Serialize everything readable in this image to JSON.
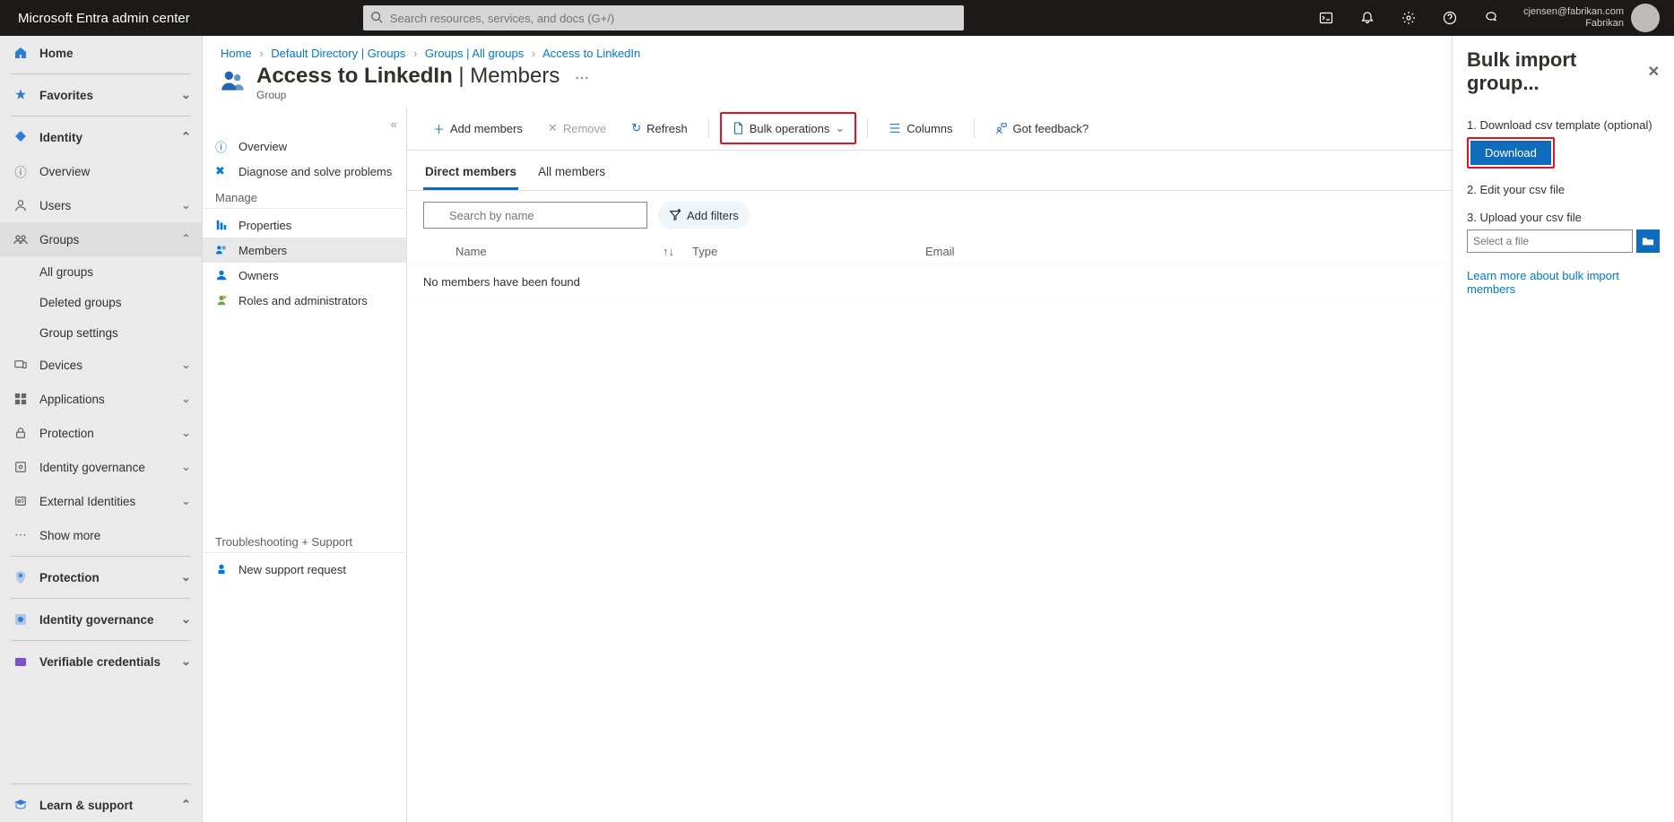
{
  "topbar": {
    "brand": "Microsoft Entra admin center",
    "search_placeholder": "Search resources, services, and docs (G+/)",
    "user_email": "cjensen@fabrikan.com",
    "user_tenant": "Fabrikan"
  },
  "sidebar": {
    "home": "Home",
    "favorites": "Favorites",
    "identity": "Identity",
    "overview": "Overview",
    "users": "Users",
    "groups": "Groups",
    "all_groups": "All groups",
    "deleted_groups": "Deleted groups",
    "group_settings": "Group settings",
    "devices": "Devices",
    "applications": "Applications",
    "protection": "Protection",
    "id_gov": "Identity governance",
    "ext_ids": "External Identities",
    "show_more": "Show more",
    "protection2": "Protection",
    "id_gov2": "Identity governance",
    "vc": "Verifiable credentials",
    "learn": "Learn & support"
  },
  "resmenu": {
    "overview": "Overview",
    "diagnose": "Diagnose and solve problems",
    "manage_h": "Manage",
    "properties": "Properties",
    "members": "Members",
    "owners": "Owners",
    "roles": "Roles and administrators",
    "trouble_h": "Troubleshooting + Support",
    "support": "New support request"
  },
  "breadcrumb": {
    "home": "Home",
    "dir": "Default Directory | Groups",
    "all": "Groups | All groups",
    "grp": "Access to LinkedIn"
  },
  "header": {
    "title_strong": "Access to LinkedIn",
    "title_thin": " | Members",
    "subtitle": "Group"
  },
  "commands": {
    "add": "Add members",
    "remove": "Remove",
    "refresh": "Refresh",
    "bulk": "Bulk operations",
    "columns": "Columns",
    "feedback": "Got feedback?"
  },
  "tabs": {
    "direct": "Direct members",
    "all": "All members"
  },
  "filters": {
    "search_placeholder": "Search by name",
    "add_filters": "Add filters"
  },
  "table": {
    "col_name": "Name",
    "col_type": "Type",
    "col_email": "Email",
    "empty": "No members have been found"
  },
  "panel": {
    "title": "Bulk import group...",
    "step1": "1. Download csv template (optional)",
    "download": "Download",
    "step2": "2. Edit your csv file",
    "step3": "3. Upload your csv file",
    "file_placeholder": "Select a file",
    "learn": "Learn more about bulk import members"
  }
}
